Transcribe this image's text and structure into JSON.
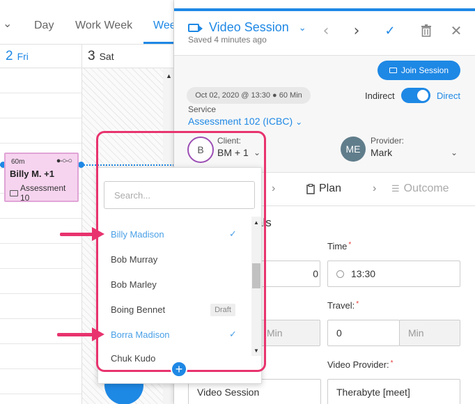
{
  "calendar": {
    "view_tabs": [
      "Day",
      "Work Week",
      "Wee"
    ],
    "active_tab": "Wee",
    "days": [
      {
        "num": "2",
        "name": "Fri"
      },
      {
        "num": "3",
        "name": "Sat"
      }
    ],
    "event": {
      "duration": "60m",
      "title": "Billy M. +1",
      "type": "Assessment 10"
    }
  },
  "panel": {
    "title": "Video Session",
    "saved": "Saved 4 minutes ago",
    "join_label": "Join Session",
    "date_chip": "Oct 02, 2020 @ 13:30 ● 60 Min",
    "indirect_label": "Indirect",
    "direct_label": "Direct",
    "service_label": "Service",
    "service_value": "Assessment 102 (ICBC)",
    "client": {
      "avatar": "B",
      "label": "Client:",
      "value": "BM + 1"
    },
    "provider": {
      "avatar": "ME",
      "label": "Provider:",
      "value": "Mark"
    },
    "steps": {
      "plan": "Plan",
      "outcome": "Outcome"
    },
    "section_tail": "als",
    "fields": {
      "time_label": "Time",
      "time_value": "13:30",
      "travel_label": "Travel:",
      "travel_value": "0",
      "travel_unit": "Min",
      "left_unit": "Min",
      "left_value": "0",
      "video_provider_label": "Video Provider:",
      "video_provider_value": "Therabyte [meet]",
      "session_type_value": "Video Session"
    }
  },
  "dropdown": {
    "search_placeholder": "Search...",
    "items": [
      {
        "label": "Billy Madison",
        "selected": true,
        "badge": ""
      },
      {
        "label": "Bob Murray",
        "selected": false,
        "badge": ""
      },
      {
        "label": "Bob Marley",
        "selected": false,
        "badge": ""
      },
      {
        "label": "Boing Bennet",
        "selected": false,
        "badge": "Draft"
      },
      {
        "label": "Borra Madison",
        "selected": true,
        "badge": ""
      },
      {
        "label": "Chuk Kudo",
        "selected": false,
        "badge": ""
      }
    ],
    "check_glyph": "✓"
  },
  "colors": {
    "accent": "#1e88e5",
    "highlight": "#e8336e",
    "event_bg": "#f6d4ef",
    "client_ring": "#9c4fb5",
    "provider_avatar": "#607d8b"
  }
}
